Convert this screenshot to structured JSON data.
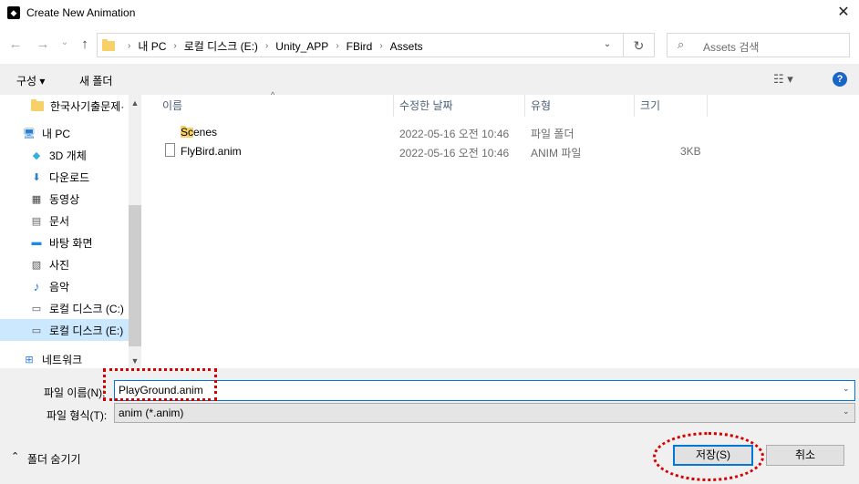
{
  "window": {
    "title": "Create New Animation",
    "close_glyph": "✕",
    "app_glyph": "◆"
  },
  "nav": {
    "back_glyph": "←",
    "forward_glyph": "→",
    "recent_glyph": "⌄",
    "up_glyph": "↑",
    "breadcrumbs": [
      "내 PC",
      "로컬 디스크 (E:)",
      "Unity_APP",
      "FBird",
      "Assets"
    ],
    "crumb_sep": "›",
    "address_dropdown_glyph": "⌄",
    "refresh_glyph": "↻",
    "search_placeholder": "Assets 검색",
    "search_glyph": "⌕"
  },
  "toolbar": {
    "organize_label": "구성 ▾",
    "new_folder_label": "새 폴더",
    "view_glyph": "☷ ▾",
    "help_glyph": "?"
  },
  "sidebar": {
    "items": [
      {
        "label": "한국사기출문제·",
        "icon": "folder-icon",
        "glyph": ""
      },
      {
        "label": "내 PC",
        "icon": "computer-icon",
        "glyph": "🖥"
      },
      {
        "label": "3D 개체",
        "icon": "cube-icon",
        "glyph": "◆"
      },
      {
        "label": "다운로드",
        "icon": "download-icon",
        "glyph": "⬇"
      },
      {
        "label": "동영상",
        "icon": "film-icon",
        "glyph": "▦"
      },
      {
        "label": "문서",
        "icon": "document-icon",
        "glyph": "▤"
      },
      {
        "label": "바탕 화면",
        "icon": "desktop-icon",
        "glyph": "▬"
      },
      {
        "label": "사진",
        "icon": "picture-icon",
        "glyph": "▧"
      },
      {
        "label": "음악",
        "icon": "music-icon",
        "glyph": "♪"
      },
      {
        "label": "로컬 디스크 (C:)",
        "icon": "drive-icon",
        "glyph": "▭"
      },
      {
        "label": "로컬 디스크 (E:)",
        "icon": "drive-icon",
        "glyph": "▭"
      },
      {
        "label": "네트워크",
        "icon": "network-icon",
        "glyph": "⊞"
      }
    ],
    "scroll_up_glyph": "▲",
    "scroll_down_glyph": "▼"
  },
  "columns": {
    "name": "이름",
    "modified": "수정한 날짜",
    "type": "유형",
    "size": "크기",
    "sort_glyph": "^"
  },
  "files": [
    {
      "name": "Scenes",
      "modified": "2022-05-16 오전 10:46",
      "type": "파일 폴더",
      "size": "",
      "icon": "folder-icon"
    },
    {
      "name": "FlyBird.anim",
      "modified": "2022-05-16 오전 10:46",
      "type": "ANIM 파일",
      "size": "3KB",
      "icon": "file-icon"
    }
  ],
  "form": {
    "filename_label": "파일 이름(N):",
    "filename_value": "PlayGround.anim",
    "filetype_label": "파일 형식(T):",
    "filetype_value": "anim (*.anim)",
    "dropdown_glyph": "⌄"
  },
  "footer": {
    "hide_folders_label": "폴더 숨기기",
    "hide_glyph": "⌃",
    "save_label": "저장(S)",
    "cancel_label": "취소"
  },
  "colors": {
    "accent": "#0078d7",
    "annotation": "#d60000",
    "selection": "#cce8ff",
    "folder": "#f7d068"
  }
}
